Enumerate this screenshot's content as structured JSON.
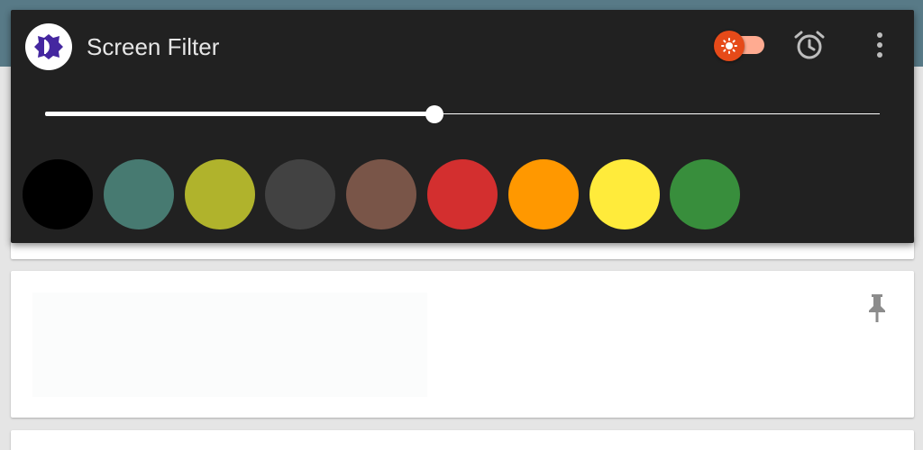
{
  "app": {
    "title": "Screen Filter",
    "logo_icon": "dimmer-logo-icon"
  },
  "filter_toggle": {
    "on": true,
    "icon": "brightness-icon",
    "thumb_color": "#e64a19",
    "track_color": "#ffab91"
  },
  "toolbar": {
    "alarm_icon": "alarm-clock-icon",
    "menu_icon": "more-vert-icon"
  },
  "intensity_slider": {
    "value": 0.466
  },
  "swatches": [
    {
      "name": "black",
      "color": "#000000"
    },
    {
      "name": "teal",
      "color": "#477a71"
    },
    {
      "name": "olive",
      "color": "#b0b32c"
    },
    {
      "name": "dark-gray",
      "color": "#424242"
    },
    {
      "name": "brown",
      "color": "#795548"
    },
    {
      "name": "red",
      "color": "#d32f2f"
    },
    {
      "name": "orange",
      "color": "#ff9800"
    },
    {
      "name": "yellow",
      "color": "#ffeb3b"
    },
    {
      "name": "green",
      "color": "#388e3c"
    }
  ],
  "background": {
    "pin_icon": "pin-icon",
    "header_color": "#587a87"
  }
}
